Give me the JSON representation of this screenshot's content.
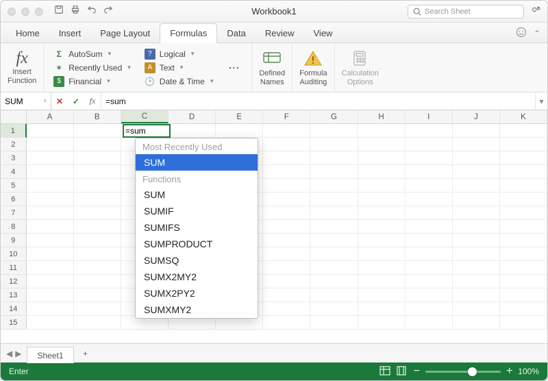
{
  "window": {
    "title": "Workbook1"
  },
  "search": {
    "placeholder": "Search Sheet"
  },
  "tabs": [
    "Home",
    "Insert",
    "Page Layout",
    "Formulas",
    "Data",
    "Review",
    "View"
  ],
  "active_tab": "Formulas",
  "ribbon": {
    "insert_function": "Insert\nFunction",
    "col1": [
      {
        "icon": "Σ",
        "label": "AutoSum",
        "name": "autosum-button"
      },
      {
        "icon": "★",
        "label": "Recently Used",
        "name": "recently-used-button"
      },
      {
        "icon": "$",
        "label": "Financial",
        "name": "financial-button"
      }
    ],
    "col2": [
      {
        "icon": "?",
        "label": "Logical",
        "name": "logical-button"
      },
      {
        "icon": "A",
        "label": "Text",
        "name": "text-button"
      },
      {
        "icon": "⏱",
        "label": "Date & Time",
        "name": "date-time-button"
      }
    ],
    "more": "⋯",
    "defined_names": "Defined\nNames",
    "formula_auditing": "Formula\nAuditing",
    "calc_options": "Calculation\nOptions"
  },
  "name_box": "SUM",
  "formula": "=sum",
  "columns": [
    "A",
    "B",
    "C",
    "D",
    "E",
    "F",
    "G",
    "H",
    "I",
    "J",
    "K"
  ],
  "rows": [
    "1",
    "2",
    "3",
    "4",
    "5",
    "6",
    "7",
    "8",
    "9",
    "10",
    "11",
    "12",
    "13",
    "14",
    "15"
  ],
  "active_col": "C",
  "active_row": "1",
  "cell_text": "=sum",
  "autocomplete": {
    "header_mru": "Most Recently Used",
    "mru": [
      "SUM"
    ],
    "header_fn": "Functions",
    "functions": [
      "SUM",
      "SUMIF",
      "SUMIFS",
      "SUMPRODUCT",
      "SUMSQ",
      "SUMX2MY2",
      "SUMX2PY2",
      "SUMXMY2"
    ],
    "selected": "SUM"
  },
  "sheet": {
    "name": "Sheet1"
  },
  "status": {
    "mode": "Enter",
    "zoom": "100%"
  }
}
